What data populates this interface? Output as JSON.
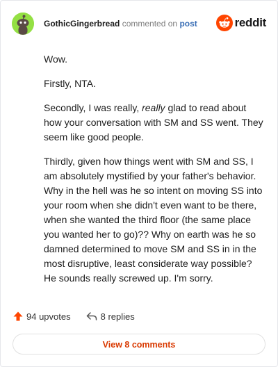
{
  "comment": {
    "username": "GothicGingerbread",
    "action": "commented on",
    "post_link": "post",
    "brand": "reddit",
    "paragraph_1": "Wow.",
    "paragraph_2": "Firstly, NTA.",
    "paragraph_3_before": "Secondly, I was really, ",
    "paragraph_3_em": "really",
    "paragraph_3_after": " glad to read about how your conversation with SM and SS went. They seem like good people.",
    "paragraph_4": "Thirdly, given how things went with SM and SS, I am absolutely mystified by your father's behavior. Why in the hell was he so intent on moving SS into your room when she didn't even want to be there, when she wanted the third floor (the same place you wanted her to go)?? Why on earth was he so damned determined to move SM and SS in in the most disruptive, least considerate way possible? He sounds really screwed up. I'm sorry."
  },
  "footer": {
    "upvotes": "94 upvotes",
    "replies": "8 replies",
    "view_button": "View 8 comments"
  },
  "icons": {
    "avatar": "snoo-avatar-icon",
    "brand": "reddit-logo-icon",
    "upvote": "upvote-arrow-icon",
    "reply": "reply-arrow-icon"
  },
  "colors": {
    "avatar_bg": "#94e044",
    "brand_orange": "#ff4500",
    "link_blue": "#3b6fb6",
    "button_text": "#d93900"
  }
}
